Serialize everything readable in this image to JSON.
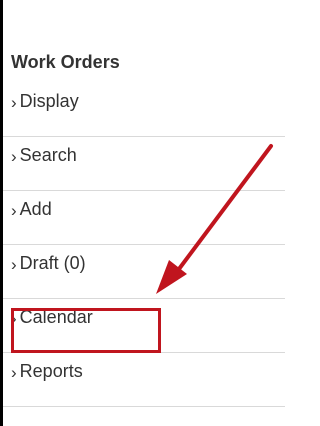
{
  "section": {
    "title": "Work Orders"
  },
  "menu": {
    "items": [
      {
        "label": "Display",
        "icon": "chevron-right-icon"
      },
      {
        "label": "Search",
        "icon": "chevron-right-icon"
      },
      {
        "label": "Add",
        "icon": "chevron-right-icon"
      },
      {
        "label": "Draft (0)",
        "icon": "chevron-right-icon"
      },
      {
        "label": "Calendar",
        "icon": "chevron-right-icon"
      },
      {
        "label": "Reports",
        "icon": "chevron-right-icon"
      }
    ]
  },
  "annotation": {
    "highlight_color": "#c0151e",
    "arrow_color": "#c0151e"
  }
}
